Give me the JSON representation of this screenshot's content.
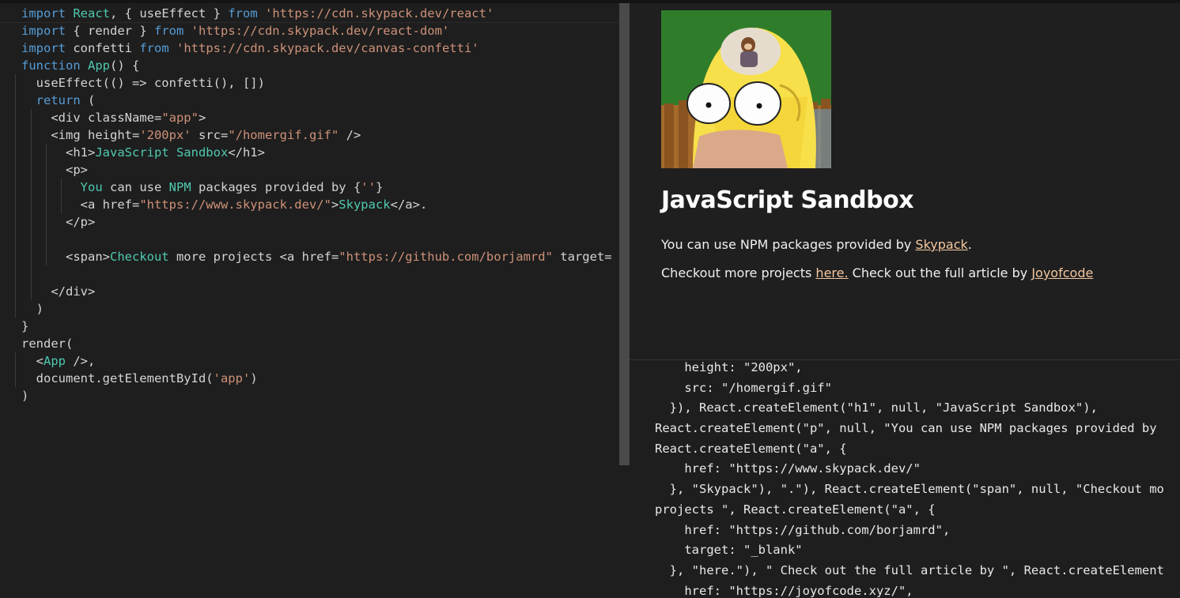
{
  "editor": {
    "lines": [
      [
        [
          "kw",
          "import"
        ],
        [
          "plain",
          " "
        ],
        [
          "fn",
          "React"
        ],
        [
          "plain",
          ", { useEffect } "
        ],
        [
          "kw",
          "from"
        ],
        [
          "plain",
          " "
        ],
        [
          "str",
          "'https://cdn.skypack.dev/react'"
        ]
      ],
      [
        [
          "kw",
          "import"
        ],
        [
          "plain",
          " { render } "
        ],
        [
          "kw",
          "from"
        ],
        [
          "plain",
          " "
        ],
        [
          "str",
          "'https://cdn.skypack.dev/react-dom'"
        ]
      ],
      [
        [
          "kw",
          "import"
        ],
        [
          "plain",
          " confetti "
        ],
        [
          "kw",
          "from"
        ],
        [
          "plain",
          " "
        ],
        [
          "str",
          "'https://cdn.skypack.dev/canvas-confetti'"
        ]
      ],
      [
        [
          "kw",
          "function"
        ],
        [
          "plain",
          " "
        ],
        [
          "fn",
          "App"
        ],
        [
          "plain",
          "() {"
        ]
      ],
      [
        [
          "plain",
          "  useEffect(() => confetti(), [])"
        ]
      ],
      [
        [
          "plain",
          "  "
        ],
        [
          "kw",
          "return"
        ],
        [
          "plain",
          " ("
        ]
      ],
      [
        [
          "plain",
          "    <div className="
        ],
        [
          "str",
          "\"app\""
        ],
        [
          "plain",
          ">"
        ]
      ],
      [
        [
          "plain",
          "    <img height="
        ],
        [
          "str",
          "'200px'"
        ],
        [
          "plain",
          " src="
        ],
        [
          "str",
          "\"/homergif.gif\""
        ],
        [
          "plain",
          " />"
        ]
      ],
      [
        [
          "plain",
          "      <h1>"
        ],
        [
          "txt",
          "JavaScript Sandbox"
        ],
        [
          "plain",
          "</h1>"
        ]
      ],
      [
        [
          "plain",
          "      <p>"
        ]
      ],
      [
        [
          "plain",
          "        "
        ],
        [
          "txt",
          "You"
        ],
        [
          "plain",
          " can use "
        ],
        [
          "txt",
          "NPM"
        ],
        [
          "plain",
          " packages provided by {"
        ],
        [
          "str",
          "''"
        ],
        [
          "plain",
          "}"
        ]
      ],
      [
        [
          "plain",
          "        <a href="
        ],
        [
          "str",
          "\"https://www.skypack.dev/\""
        ],
        [
          "plain",
          ">"
        ],
        [
          "txt",
          "Skypack"
        ],
        [
          "plain",
          "</a>."
        ]
      ],
      [
        [
          "plain",
          "      </p>"
        ]
      ],
      [
        [
          "plain",
          ""
        ]
      ],
      [
        [
          "plain",
          "      <span>"
        ],
        [
          "txt",
          "Checkout"
        ],
        [
          "plain",
          " more projects <a href="
        ],
        [
          "str",
          "\"https://github.com/borjamrd\""
        ],
        [
          "plain",
          " target="
        ]
      ],
      [
        [
          "plain",
          ""
        ]
      ],
      [
        [
          "plain",
          "    </div>"
        ]
      ],
      [
        [
          "plain",
          "  )"
        ]
      ],
      [
        [
          "plain",
          "}"
        ]
      ],
      [
        [
          "plain",
          "render("
        ]
      ],
      [
        [
          "plain",
          "  <"
        ],
        [
          "fn",
          "App"
        ],
        [
          "plain",
          " />,"
        ]
      ],
      [
        [
          "plain",
          "  document.getElementById("
        ],
        [
          "str",
          "'app'"
        ],
        [
          "plain",
          ")"
        ]
      ],
      [
        [
          "plain",
          ")"
        ]
      ]
    ]
  },
  "preview": {
    "image_alt": "homer gif",
    "title": "JavaScript Sandbox",
    "p1_text": "You can use NPM packages provided by ",
    "p1_link": "Skypack",
    "p1_end": ".",
    "p2_text": "Checkout more projects ",
    "p2_link1": "here.",
    "p2_mid": " Check out the full article by ",
    "p2_link2": "Joyofcode"
  },
  "output": {
    "lines": [
      "    height: \"200px\",",
      "    src: \"/homergif.gif\"",
      "  }), React.createElement(\"h1\", null, \"JavaScript Sandbox\"),",
      "React.createElement(\"p\", null, \"You can use NPM packages provided by ",
      "React.createElement(\"a\", {",
      "    href: \"https://www.skypack.dev/\"",
      "  }, \"Skypack\"), \".\"), React.createElement(\"span\", null, \"Checkout mo",
      "projects \", React.createElement(\"a\", {",
      "    href: \"https://github.com/borjamrd\",",
      "    target: \"_blank\"",
      "  }, \"here.\"), \" Check out the full article by \", React.createElement",
      "    href: \"https://joyofcode.xyz/\","
    ]
  }
}
